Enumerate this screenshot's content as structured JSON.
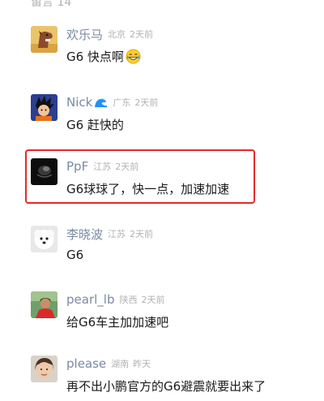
{
  "header": {
    "label": "留言 14"
  },
  "comments": [
    {
      "username": "欢乐马",
      "location": "北京",
      "time": "2天前",
      "text": "G6 快点啊",
      "emoji": "grin-face"
    },
    {
      "username": "Nick",
      "location": "广东",
      "time": "2天前",
      "text": "G6 赶快的",
      "username_emoji": "wave"
    },
    {
      "username": "PpF",
      "location": "江苏",
      "time": "2天前",
      "text": "G6球球了，快一点，加速加速"
    },
    {
      "username": "李晓波",
      "location": "江苏",
      "time": "2天前",
      "text": "G6"
    },
    {
      "username": "pearl_lb",
      "location": "陕西",
      "time": "2天前",
      "text": "给G6车主加加速吧"
    },
    {
      "username": "please",
      "location": "湖南",
      "time": "昨天",
      "text": "再不出小鹏官方的G6避震就要出来了"
    }
  ],
  "colors": {
    "username": "#7a8aa3",
    "meta": "#b2b2b2",
    "text": "#1a1a1a",
    "highlight_border": "#e5292b"
  }
}
